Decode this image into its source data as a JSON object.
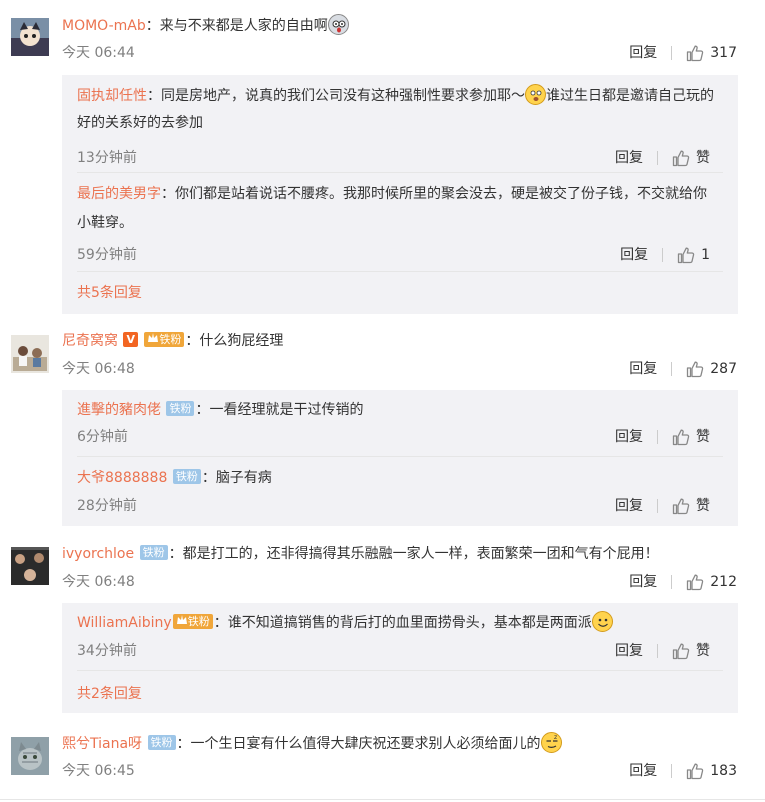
{
  "comments": [
    {
      "user": "MOMO-mAb",
      "text": "来与不来都是人家的自由啊",
      "time": "今天 06:44",
      "reply_label": "回复",
      "likes": "317",
      "replies": [
        {
          "user": "固执却任性",
          "text_a": "同是房地产，说真的我们公司没有这种强制性要求参加耶～",
          "text_b": "谁过生日都是邀请自己玩的好的关系好的去参加",
          "time": "13分钟前",
          "reply_label": "回复",
          "likes": "赞"
        },
        {
          "user": "最后的美男字",
          "text": "你们都是站着说话不腰疼。我那时候所里的聚会没去，硬是被交了份子钱，不交就给你小鞋穿。",
          "time": "59分钟前",
          "reply_label": "回复",
          "likes": "1"
        }
      ],
      "more": "共5条回复"
    },
    {
      "user": "尼奇窝窝",
      "badge_v": "V",
      "badge_fan": "铁粉",
      "text": "什么狗屁经理",
      "time": "今天 06:48",
      "reply_label": "回复",
      "likes": "287",
      "replies": [
        {
          "user": "進擊的豬肉佬",
          "badge": "铁粉",
          "text": "一看经理就是干过传销的",
          "time": "6分钟前",
          "reply_label": "回复",
          "likes": "赞"
        },
        {
          "user": "大爷8888888",
          "badge": "铁粉",
          "text": "脑子有病",
          "time": "28分钟前",
          "reply_label": "回复",
          "likes": "赞"
        }
      ]
    },
    {
      "user": "ivyorchloe",
      "badge": "铁粉",
      "text": "都是打工的，还非得搞得其乐融融一家人一样，表面繁荣一团和气有个屁用！",
      "time": "今天 06:48",
      "reply_label": "回复",
      "likes": "212",
      "replies": [
        {
          "user": "WilliamAibiny",
          "badge_fan": "铁粉",
          "text": "谁不知道搞销售的背后打的血里面捞骨头，基本都是两面派",
          "time": "34分钟前",
          "reply_label": "回复",
          "likes": "赞"
        }
      ],
      "more": "共2条回复"
    },
    {
      "user": "熙兮Tiana呀",
      "badge": "铁粉",
      "text": "一个生日宴有什么值得大肆庆祝还要求别人必须给面儿的",
      "time": "今天 06:45",
      "reply_label": "回复",
      "likes": "183"
    }
  ],
  "colors": {
    "username": "#eb7350",
    "reply_bg": "#f2f2f5",
    "iron_badge": "#9ec6e8"
  },
  "icons": {
    "like": "thumb-up-icon"
  }
}
